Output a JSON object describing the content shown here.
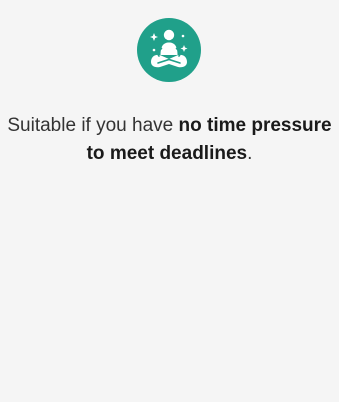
{
  "option": {
    "icon": "meditation-person-icon",
    "text_prefix": "Suitable if you have ",
    "text_bold": "no time pressure to meet deadlines",
    "text_suffix": "."
  },
  "colors": {
    "icon_background": "#20a08a",
    "icon_foreground": "#ffffff",
    "page_background": "#f5f5f5",
    "text": "#333333"
  }
}
